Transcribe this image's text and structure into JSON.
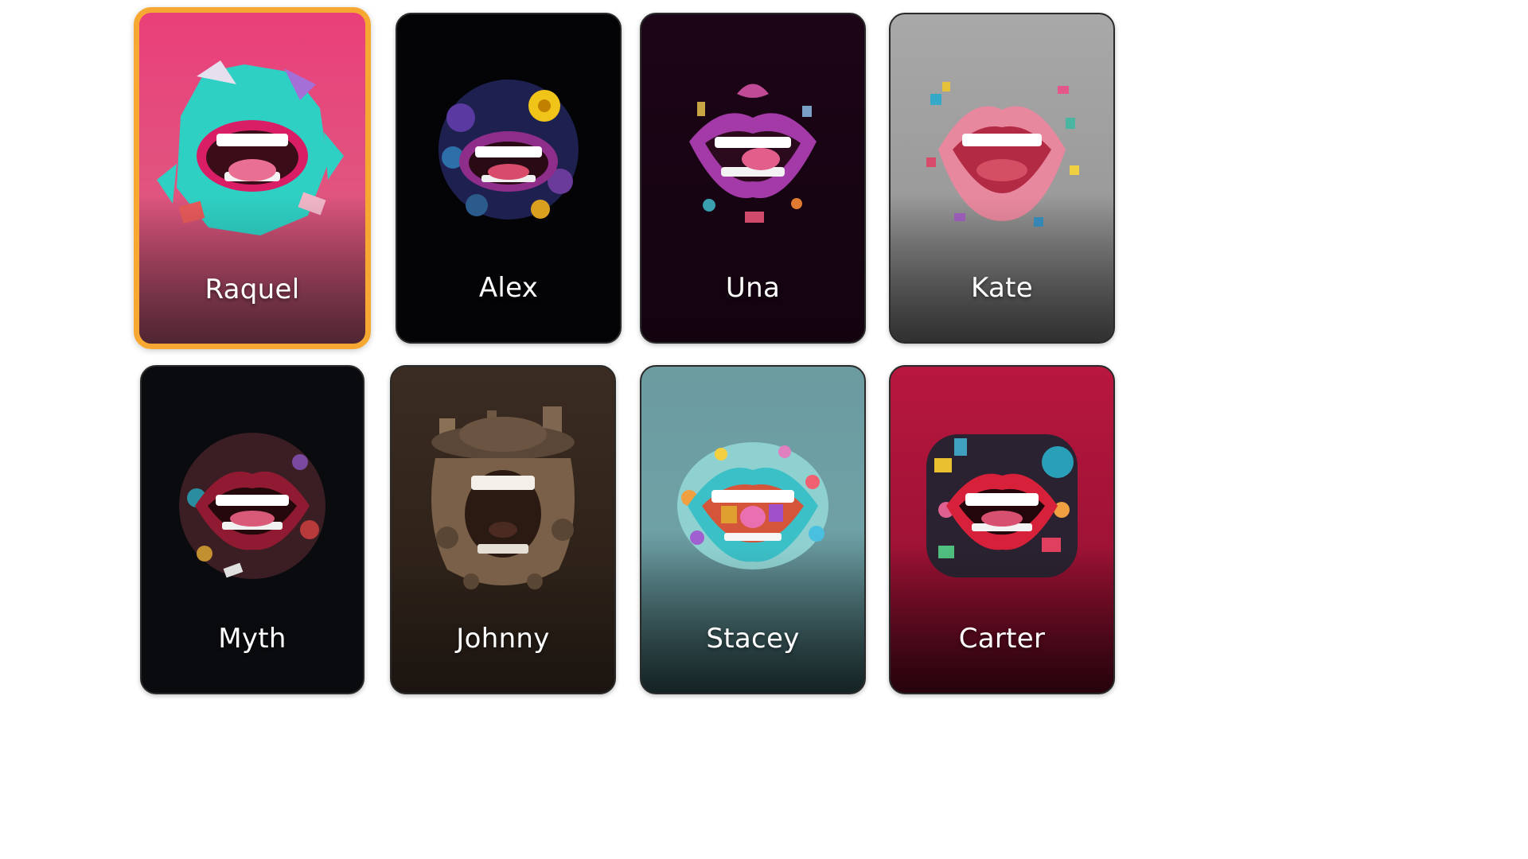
{
  "voices": [
    {
      "name": "Raquel",
      "selected": true,
      "bg_top": "#ea3f7a",
      "bg_bottom": "#7a3a4c",
      "art": "mouth-graffiti-teal-icon"
    },
    {
      "name": "Alex",
      "selected": false,
      "bg_top": "#050508",
      "bg_bottom": "#050508",
      "art": "mouth-floral-icon"
    },
    {
      "name": "Una",
      "selected": false,
      "bg_top": "#1a0414",
      "bg_bottom": "#12030f",
      "art": "mouth-purple-lips-icon"
    },
    {
      "name": "Kate",
      "selected": false,
      "bg_top": "#a7a7a7",
      "bg_bottom": "#4b4b4b",
      "art": "mouth-pixel-pink-icon"
    },
    {
      "name": "Myth",
      "selected": false,
      "bg_top": "#0c0d10",
      "bg_bottom": "#07080a",
      "art": "mouth-dark-collage-icon"
    },
    {
      "name": "Johnny",
      "selected": false,
      "bg_top": "#3a2c22",
      "bg_bottom": "#1e1713",
      "art": "mouth-bronze-machinery-icon"
    },
    {
      "name": "Stacey",
      "selected": false,
      "bg_top": "#6f9ea3",
      "bg_bottom": "#233a3d",
      "art": "mouth-candy-teal-icon"
    },
    {
      "name": "Carter",
      "selected": false,
      "bg_top": "#b0143c",
      "bg_bottom": "#3a0612",
      "art": "mouth-red-collage-icon"
    }
  ]
}
